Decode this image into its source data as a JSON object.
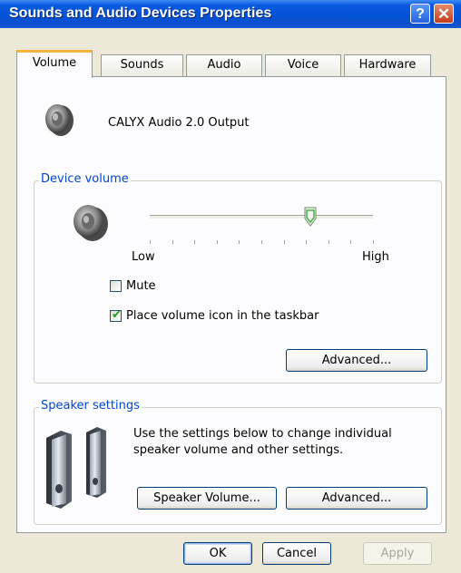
{
  "window": {
    "title": "Sounds and Audio Devices Properties",
    "help_glyph": "?",
    "close_glyph": "✕"
  },
  "tabs": [
    {
      "label": "Volume",
      "selected": true
    },
    {
      "label": "Sounds",
      "selected": false
    },
    {
      "label": "Audio",
      "selected": false
    },
    {
      "label": "Voice",
      "selected": false
    },
    {
      "label": "Hardware",
      "selected": false
    }
  ],
  "device": {
    "name": "CALYX Audio 2.0 Output",
    "icon": "speaker-icon"
  },
  "device_volume": {
    "legend": "Device volume",
    "icon": "speaker-icon",
    "slider_value_fraction": 0.72,
    "tick_count": 11,
    "low_label": "Low",
    "high_label": "High",
    "mute_label": "Mute",
    "mute_checked": false,
    "taskbar_label": "Place volume icon in the taskbar",
    "taskbar_checked": true,
    "advanced_button": "Advanced..."
  },
  "speaker_settings": {
    "legend": "Speaker settings",
    "icon": "desktop-speakers-icon",
    "description_line1": "Use the settings below to change individual",
    "description_line2": "speaker volume and other settings.",
    "speaker_volume_button": "Speaker Volume...",
    "advanced_button": "Advanced..."
  },
  "footer": {
    "ok": "OK",
    "cancel": "Cancel",
    "apply": "Apply",
    "apply_enabled": false
  },
  "colors": {
    "titlebar": "#0553d6",
    "dialog_bg": "#ece9d8",
    "panel_bg": "#fcfcfe",
    "group_legend": "#0046d5",
    "active_tab_accent": "#f6b43e",
    "check_mark": "#21a121"
  }
}
